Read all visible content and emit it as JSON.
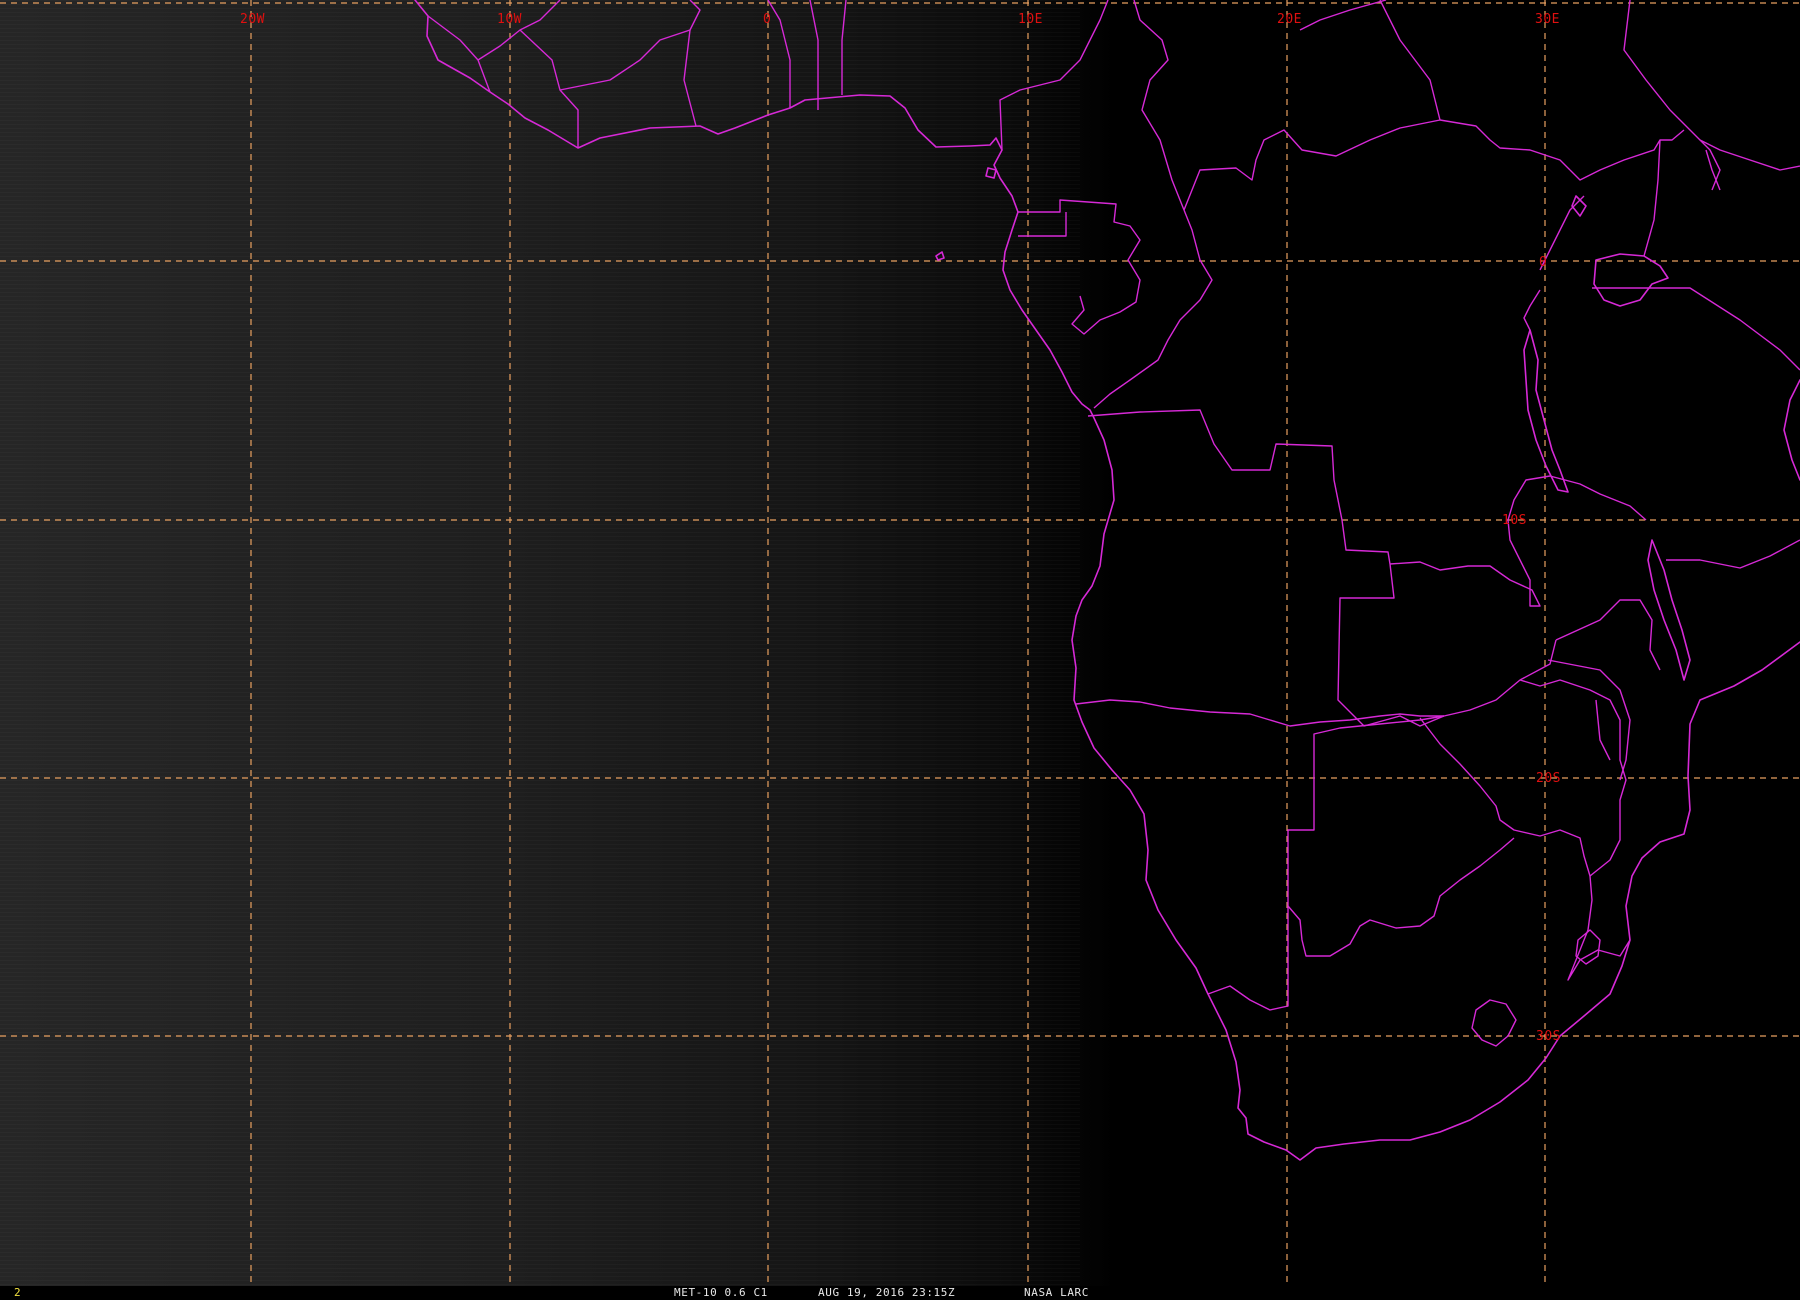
{
  "grid": {
    "meridians": [
      "20W",
      "10W",
      "0",
      "10E",
      "20E",
      "30E"
    ],
    "parallels": [
      "0",
      "10S",
      "20S",
      "30S"
    ]
  },
  "status": {
    "frame": "2",
    "satellite": "MET-10 0.6 C1",
    "datetime": "AUG 19, 2016 23:15Z",
    "source": "NASA LARC"
  },
  "colors": {
    "background": "#000000",
    "map_lines": "#d629d6",
    "grid_lines": "#e8a060",
    "grid_labels": "#e01010",
    "frame_number": "#f0e040"
  }
}
